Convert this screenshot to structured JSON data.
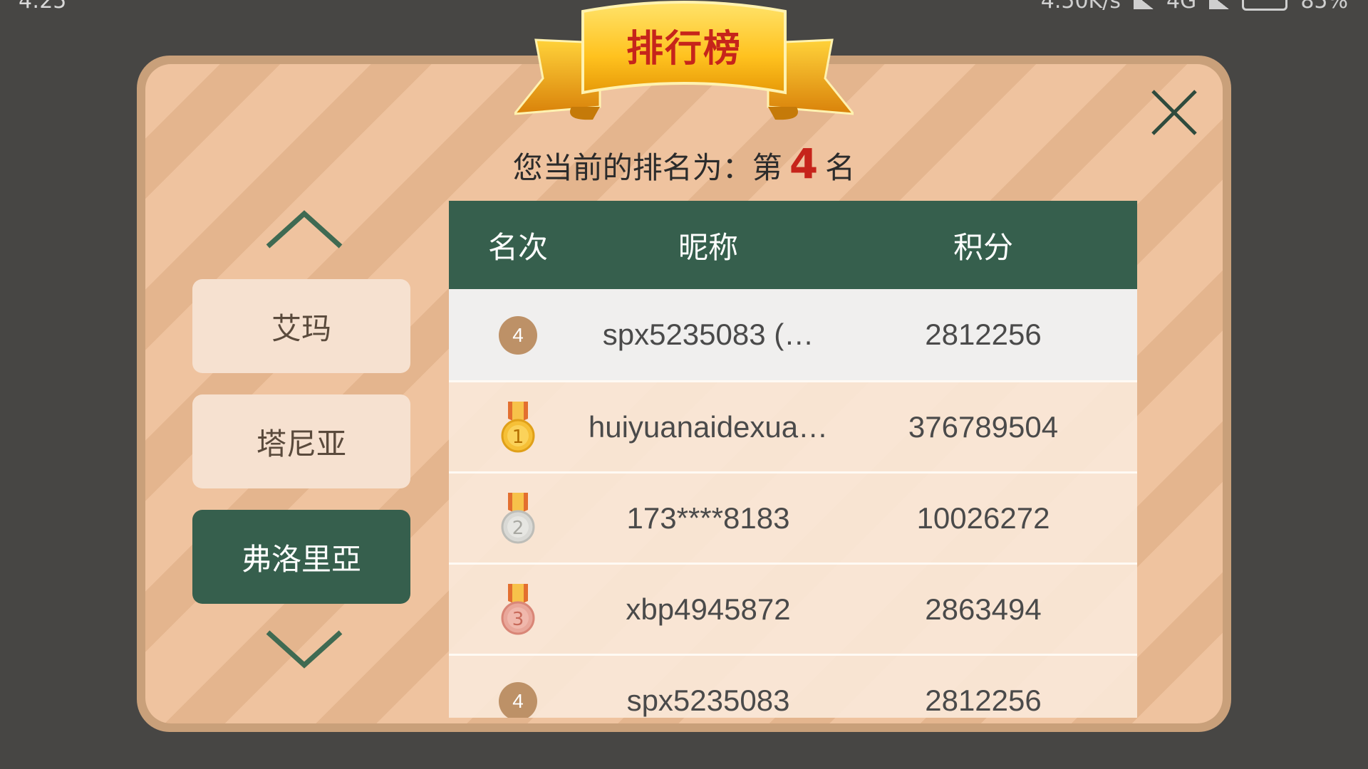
{
  "status_bar": {
    "time": "4:25",
    "speed": "4.50K/s",
    "network": "4G",
    "battery": "85%"
  },
  "banner": {
    "title": "排行榜"
  },
  "rank_info": {
    "prefix": "您当前的排名为：第",
    "rank": "4",
    "suffix": "名"
  },
  "categories": [
    {
      "label": "艾玛"
    },
    {
      "label": "塔尼亚"
    },
    {
      "label": "弗洛里亞",
      "active": true
    }
  ],
  "table": {
    "headers": {
      "rank": "名次",
      "nickname": "昵称",
      "score": "积分"
    },
    "rows": [
      {
        "rank": "4",
        "badge": "rank-circle",
        "name": "spx5235083 (…",
        "score": "2812256"
      },
      {
        "rank": "1",
        "badge": "gold-medal-icon",
        "name": "huiyuanaidexua…",
        "score": "376789504"
      },
      {
        "rank": "2",
        "badge": "silver-medal-icon",
        "name": "173****8183",
        "score": "10026272"
      },
      {
        "rank": "3",
        "badge": "bronze-medal-icon",
        "name": "xbp4945872",
        "score": "2863494"
      },
      {
        "rank": "4",
        "badge": "rank-circle",
        "name": "spx5235083",
        "score": "2812256"
      }
    ]
  },
  "colors": {
    "accent_green": "#365f4d",
    "rank_red": "#c6241b",
    "panel_peach": "#efc39f"
  }
}
